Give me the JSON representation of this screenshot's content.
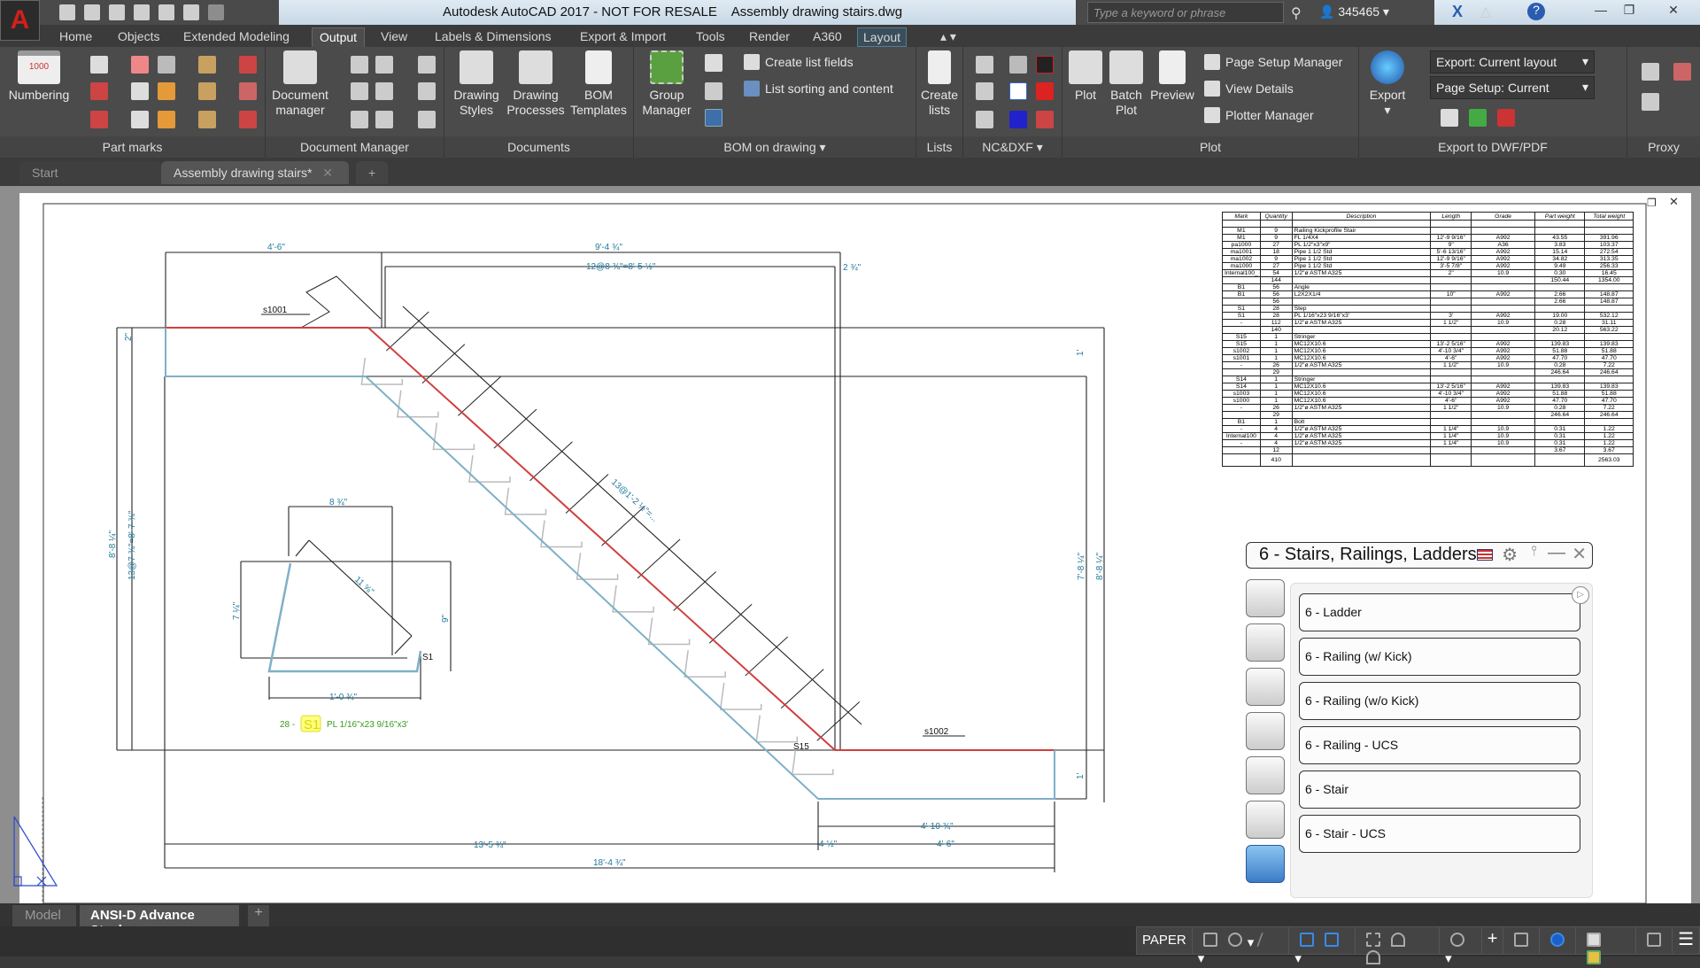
{
  "app": {
    "title": "Autodesk AutoCAD 2017 - NOT FOR RESALE",
    "file": "Assembly drawing stairs.dwg",
    "logo": "A",
    "search_placeholder": "Type a keyword or phrase",
    "user": "345465"
  },
  "ribbon_tabs": [
    "Home",
    "Objects",
    "Extended Modeling",
    "Output",
    "View",
    "Labels & Dimensions",
    "Export & Import",
    "Tools",
    "Render",
    "A360",
    "Layout"
  ],
  "active_tab": "Output",
  "panels": {
    "part_marks": {
      "title": "Part marks",
      "numbering": "Numbering"
    },
    "doc_manager": {
      "title": "Document Manager",
      "btn": "Document manager"
    },
    "documents": {
      "title": "Documents",
      "drawing_styles": "Drawing Styles",
      "drawing_processes": "Drawing Processes",
      "bom_templates": "BOM Templates"
    },
    "bom": {
      "title": "BOM on drawing",
      "group_manager": "Group Manager",
      "create_list_fields": "Create list fields",
      "list_sorting": "List sorting and content"
    },
    "lists": {
      "title": "Lists",
      "create_lists": "Create lists"
    },
    "ncdxf": {
      "title": "NC&DXF"
    },
    "plot": {
      "title": "Plot",
      "plot": "Plot",
      "batch_plot": "Batch Plot",
      "preview": "Preview",
      "page_setup_manager": "Page Setup Manager",
      "view_details": "View Details",
      "plotter_manager": "Plotter Manager"
    },
    "export": {
      "title": "Export to DWF/PDF",
      "export": "Export",
      "export_dd": "Export: Current layout",
      "page_setup_dd": "Page Setup: Current"
    },
    "proxy": {
      "title": "Proxy"
    }
  },
  "doc_tabs": [
    "Start",
    "Assembly drawing stairs*"
  ],
  "bom_table": {
    "headers": [
      "Mark",
      "Quantity",
      "Description",
      "Length",
      "Grade",
      "Part weight",
      "Total weight"
    ],
    "rows": [
      [
        "",
        "",
        "",
        "",
        "",
        "",
        ""
      ],
      [
        "M1",
        "9",
        "Railing Kickprofile Stair",
        "",
        "",
        "",
        ""
      ],
      [
        "M1",
        "9",
        "FL 1/4X4",
        "12'-9 9/16\"",
        "A992",
        "43.55",
        "391.96"
      ],
      [
        "pa1000",
        "27",
        "PL 1/2\"x3\"x9\"",
        "9\"",
        "A36",
        "3.83",
        "103.37"
      ],
      [
        "ma1001",
        "18",
        "Pipe 1 1/2 Std",
        "5'-6 13/16\"",
        "A992",
        "15.14",
        "272.54"
      ],
      [
        "ma1002",
        "9",
        "Pipe 1 1/2 Std",
        "12'-9 9/16\"",
        "A992",
        "34.82",
        "313.35"
      ],
      [
        "ma1000",
        "27",
        "Pipe 1 1/2 Std",
        "3'-5 7/8\"",
        "A992",
        "9.49",
        "256.33"
      ],
      [
        "Internal100_",
        "54",
        "1/2\"ø ASTM A325",
        "2\"",
        "10.9",
        "0.30",
        "16.45"
      ],
      [
        "",
        "144",
        "",
        "",
        "",
        "150.44",
        "1354.00"
      ],
      [
        "B1",
        "56",
        "Angle",
        "",
        "",
        "",
        ""
      ],
      [
        "B1",
        "56",
        "L2X2X1/4",
        "10\"",
        "A992",
        "2.66",
        "148.87"
      ],
      [
        "",
        "56",
        "",
        "",
        "",
        "2.66",
        "148.87"
      ],
      [
        "S1",
        "28",
        "Step",
        "",
        "",
        "",
        ""
      ],
      [
        "S1",
        "28",
        "PL 1/16\"x23 9/16\"x3'",
        "3'",
        "A992",
        "19.00",
        "532.12"
      ],
      [
        "-",
        "112",
        "1/2\"ø ASTM A325",
        "1 1/2\"",
        "10.9",
        "0.28",
        "31.11"
      ],
      [
        "",
        "140",
        "",
        "",
        "",
        "20.12",
        "563.22"
      ],
      [
        "S15",
        "1",
        "Stringer",
        "",
        "",
        "",
        ""
      ],
      [
        "S15",
        "1",
        "MC12X10.6",
        "13'-2 5/16\"",
        "A992",
        "139.83",
        "139.83"
      ],
      [
        "s1002",
        "1",
        "MC12X10.6",
        "4'-10 3/4\"",
        "A992",
        "51.88",
        "51.88"
      ],
      [
        "s1001",
        "1",
        "MC12X10.6",
        "4'-6\"",
        "A992",
        "47.70",
        "47.70"
      ],
      [
        "-",
        "26",
        "1/2\"ø ASTM A325",
        "1 1/2\"",
        "10.9",
        "0.28",
        "7.22"
      ],
      [
        "",
        "29",
        "",
        "",
        "",
        "246.64",
        "246.64"
      ],
      [
        "S14",
        "1",
        "Stringer",
        "",
        "",
        "",
        ""
      ],
      [
        "S14",
        "1",
        "MC12X10.6",
        "13'-2 5/16\"",
        "A992",
        "139.83",
        "139.83"
      ],
      [
        "s1003",
        "1",
        "MC12X10.6",
        "4'-10 3/4\"",
        "A992",
        "51.88",
        "51.88"
      ],
      [
        "s1000",
        "1",
        "MC12X10.6",
        "4'-6\"",
        "A992",
        "47.70",
        "47.70"
      ],
      [
        "-",
        "26",
        "1/2\"ø ASTM A325",
        "1 1/2\"",
        "10.9",
        "0.28",
        "7.22"
      ],
      [
        "",
        "29",
        "",
        "",
        "",
        "246.64",
        "246.64"
      ],
      [
        "B1",
        "1",
        "Bolt",
        "",
        "",
        "",
        ""
      ],
      [
        "-",
        "4",
        "1/2\"ø ASTM A325",
        "1 1/4\"",
        "10.9",
        "0.31",
        "1.22"
      ],
      [
        "Internal100",
        "4",
        "1/2\"ø ASTM A325",
        "1 1/4\"",
        "10.9",
        "0.31",
        "1.22"
      ],
      [
        "-",
        "4",
        "1/2\"ø ASTM A325",
        "1 1/4\"",
        "10.9",
        "0.31",
        "1.22"
      ],
      [
        "",
        "12",
        "",
        "",
        "",
        "3.67",
        "3.67"
      ],
      [
        "",
        "410",
        "",
        "",
        "",
        "",
        "2563.03"
      ]
    ]
  },
  "drawing": {
    "top_left": "4'-6\"",
    "top_total": "9'-4 ¾\"",
    "steps_run": "12@8 ¾\"=8'-5 ½\"",
    "top_right": "2 ¾\"",
    "s1001": "s1001",
    "s1002": "s1002",
    "s15": "S15",
    "landing_h": "2\"",
    "bottom_1": "13'-5 ¾\"",
    "bottom_2": "18'-4 ¾\"",
    "bottom_r1": "4'-10 ¾\"",
    "bottom_r2": "4'-6\"",
    "bottom_small": "4 ½\"",
    "left_1": "8'-8 ¼\"",
    "left_2": "13@7 ¾\"=8'-7 ¾\"",
    "right_1": "7'-8 ¼\"",
    "right_2": "8'-8 ¼\"",
    "right_top": "1'",
    "right_bot": "1'",
    "diag": "13@1'-2 ½\"=...",
    "step_w": "8 ¾\"",
    "step_h": "7 ¼\"",
    "step_diag": "11 ⅝\"",
    "step_9": "9\"",
    "step_len": "1'-0 ¾\"",
    "step_mark": "S1",
    "step_qty": "28 -",
    "step_badge": "S1",
    "step_desc": "PL 1/16\"x23 9/16\"x3'"
  },
  "stairs_palette": {
    "title": "6 - Stairs, Railings, Ladders",
    "items": [
      "6 - Ladder",
      "6 - Railing (w/ Kick)",
      "6 - Railing (w/o Kick)",
      "6 - Railing - UCS",
      "6 - Stair",
      "6 - Stair - UCS"
    ]
  },
  "layout_tabs": [
    "Model",
    "ANSI-D Advance Steel"
  ],
  "status": {
    "paper": "PAPER"
  },
  "colors": {
    "accent_red": "#d0201c",
    "stringer_red": "#d04040",
    "dim_blue": "#1f7a9e",
    "profile_blue": "#7fb0c8"
  }
}
